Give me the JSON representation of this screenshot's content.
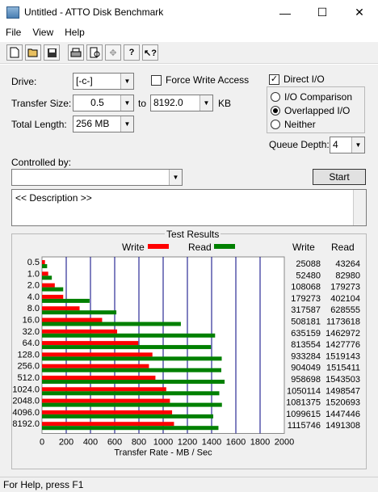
{
  "window": {
    "title": "Untitled - ATTO Disk Benchmark",
    "minimize": "—",
    "maximize": "☐",
    "close": "✕"
  },
  "menu": [
    "File",
    "View",
    "Help"
  ],
  "toolbar": {
    "icons": [
      "new-file-icon",
      "open-folder-icon",
      "save-disk-icon",
      "print-icon",
      "print-preview-icon",
      "move-icon",
      "help-icon",
      "context-help-icon"
    ]
  },
  "form": {
    "drive_label": "Drive:",
    "drive_value": "[-c-]",
    "transfer_size_label": "Transfer Size:",
    "transfer_from": "0.5",
    "to_label": "to",
    "transfer_to": "8192.0",
    "kb_label": "KB",
    "total_length_label": "Total Length:",
    "total_length": "256 MB",
    "force_write_label": "Force Write Access",
    "force_write_checked": false,
    "direct_io_label": "Direct I/O",
    "direct_io_checked": true,
    "io_comparison_label": "I/O Comparison",
    "overlapped_io_label": "Overlapped I/O",
    "neither_label": "Neither",
    "selected_io_mode": "Overlapped I/O",
    "queue_depth_label": "Queue Depth:",
    "queue_depth": "4",
    "controlled_by_label": "Controlled by:",
    "controlled_by_value": "",
    "start_label": "Start",
    "description": "<< Description >>"
  },
  "results": {
    "group_label": "Test Results",
    "legend_write": "Write",
    "legend_read": "Read",
    "col_write": "Write",
    "col_read": "Read",
    "xlabel": "Transfer Rate - MB / Sec",
    "write_color": "#ff0000",
    "read_color": "#008000"
  },
  "chart_data": {
    "type": "bar",
    "orientation": "horizontal",
    "xlabel": "Transfer Rate - MB / Sec",
    "xlim": [
      0,
      2000
    ],
    "xticks": [
      "0",
      "200",
      "400",
      "600",
      "800",
      "1000",
      "1200",
      "1400",
      "1600",
      "1800",
      "2000"
    ],
    "categories": [
      "0.5",
      "1.0",
      "2.0",
      "4.0",
      "8.0",
      "16.0",
      "32.0",
      "64.0",
      "128.0",
      "256.0",
      "512.0",
      "1024.0",
      "2048.0",
      "4096.0",
      "8192.0"
    ],
    "series": [
      {
        "name": "Write",
        "values": [
          25088,
          52480,
          108068,
          179273,
          317587,
          508181,
          635159,
          813554,
          933284,
          904049,
          958698,
          1050114,
          1081375,
          1099615,
          1115746
        ]
      },
      {
        "name": "Read",
        "values": [
          43264,
          82980,
          179273,
          402104,
          628555,
          1173618,
          1462972,
          1427776,
          1519143,
          1515411,
          1543503,
          1498547,
          1520693,
          1447446,
          1491308
        ]
      }
    ],
    "units_note": ""
  },
  "status": {
    "text": "For Help, press F1"
  }
}
